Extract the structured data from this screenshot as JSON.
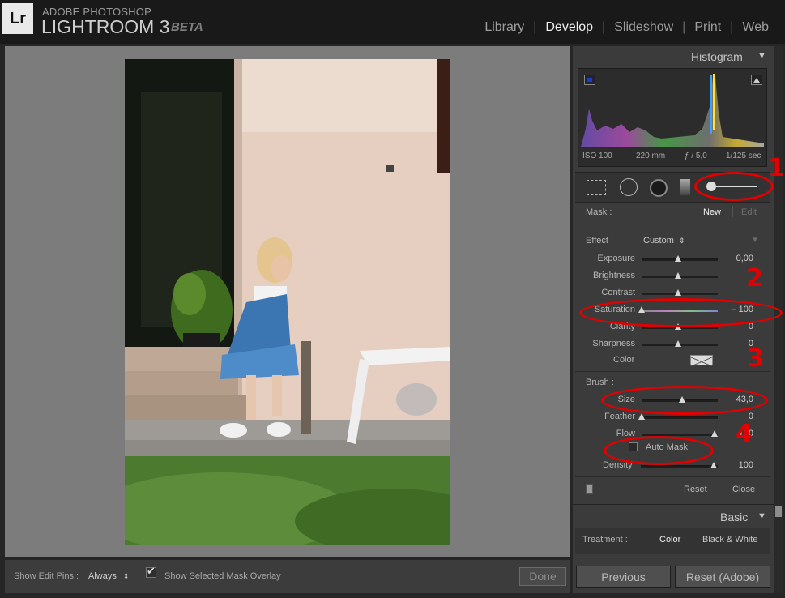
{
  "app": {
    "logo": "Lr",
    "brand_line1": "ADOBE PHOTOSHOP",
    "brand_line2": "LIGHTROOM 3",
    "brand_beta": "BETA"
  },
  "modules": [
    "Library",
    "Develop",
    "Slideshow",
    "Print",
    "Web"
  ],
  "active_module": "Develop",
  "histogram": {
    "title": "Histogram",
    "iso": "ISO 100",
    "focal": "220 mm",
    "aperture": "ƒ / 5,0",
    "shutter": "1/125 sec"
  },
  "tools": [
    "crop-overlay-icon",
    "spot-removal-icon",
    "red-eye-icon",
    "graduated-filter-icon",
    "adjustment-brush-icon"
  ],
  "mask": {
    "label": "Mask :",
    "new": "New",
    "edit": "Edit"
  },
  "effect": {
    "label": "Effect :",
    "preset": "Custom",
    "sliders": [
      {
        "label": "Exposure",
        "value": "0,00",
        "pos": 0.5
      },
      {
        "label": "Brightness",
        "value": "",
        "pos": 0.5
      },
      {
        "label": "Contrast",
        "value": "",
        "pos": 0.5
      },
      {
        "label": "Saturation",
        "value": "– 100",
        "pos": 0.0
      },
      {
        "label": "Clarity",
        "value": "0",
        "pos": 0.5
      },
      {
        "label": "Sharpness",
        "value": "0",
        "pos": 0.5
      }
    ],
    "color_label": "Color"
  },
  "brush": {
    "label": "Brush :",
    "sliders": [
      {
        "label": "Size",
        "value": "43,0",
        "pos": 0.55
      },
      {
        "label": "Feather",
        "value": "0",
        "pos": 0.0
      },
      {
        "label": "Flow",
        "value": "100",
        "pos": 1.0
      }
    ],
    "auto_mask": "Auto Mask",
    "density": {
      "label": "Density",
      "value": "100",
      "pos": 1.0
    }
  },
  "brush_footer": {
    "reset": "Reset",
    "close": "Close"
  },
  "basic": {
    "title": "Basic",
    "treatment_label": "Treatment :",
    "color": "Color",
    "bw": "Black & White"
  },
  "bottom_bar": {
    "show_pins_label": "Show Edit Pins :",
    "show_pins_value": "Always",
    "overlay_label": "Show Selected Mask Overlay",
    "done": "Done"
  },
  "nav_buttons": {
    "previous": "Previous",
    "reset": "Reset (Adobe)"
  },
  "annotations": [
    "1",
    "2",
    "3",
    "4"
  ],
  "colors": {
    "annotation_red": "#e20000",
    "panel_bg": "#3b3b3b",
    "image_bg": "#7c7c7c"
  }
}
